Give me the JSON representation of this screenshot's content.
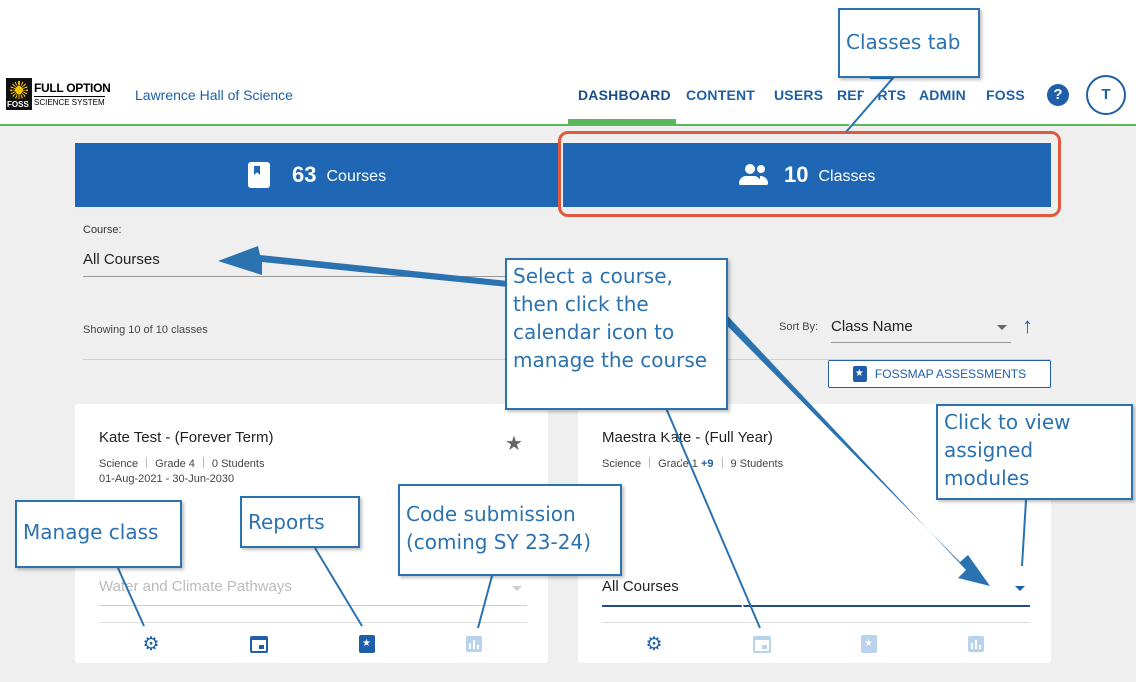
{
  "header": {
    "logo_line1": "FULL OPTION",
    "logo_line2": "SCIENCE SYSTEM",
    "logo_mark": "FOSS",
    "org_name": "Lawrence Hall of Science",
    "nav": [
      {
        "label": "DASHBOARD",
        "active": true
      },
      {
        "label": "CONTENT"
      },
      {
        "label": "USERS"
      },
      {
        "label": "REPORTS"
      },
      {
        "label": "ADMIN"
      },
      {
        "label": "FOSS"
      }
    ],
    "help_label": "?",
    "avatar_initial": "T"
  },
  "stats": {
    "courses": {
      "count": "63",
      "label": "Courses",
      "icon": "book-icon"
    },
    "classes": {
      "count": "10",
      "label": "Classes",
      "icon": "people-icon"
    }
  },
  "filters": {
    "course_label": "Course:",
    "course_value": "All Courses",
    "showing": "Showing 10 of 10 classes",
    "sort_label": "Sort By:",
    "sort_value": "Class Name",
    "sort_direction_icon": "↑",
    "fossmap_label": "FOSSMAP ASSESSMENTS"
  },
  "cards": [
    {
      "title": "Kate Test - (Forever Term)",
      "subject": "Science",
      "grade": "Grade 4",
      "students": "0 Students",
      "dates": "01-Aug-2021 - 30-Jun-2030",
      "star": "★",
      "module": "Water and Climate Pathways"
    },
    {
      "title": "Maestra Kate - (Full Year)",
      "subject": "Science",
      "grade": "Grade 1",
      "grade_more": "+9",
      "students": "9 Students",
      "module": "All Courses"
    }
  ],
  "annotations": {
    "classes_tab": "Classes tab",
    "select_course": [
      "Select a course,",
      "then click the",
      "calendar icon to",
      "manage the course"
    ],
    "view_modules": [
      "Click to view",
      "assigned",
      "modules"
    ],
    "manage_class": "Manage class",
    "reports": "Reports",
    "code_submission": [
      "Code submission",
      "(coming SY 23-24)"
    ],
    "accent_color": "#2a72b0",
    "highlight_color": "#e2583e"
  }
}
